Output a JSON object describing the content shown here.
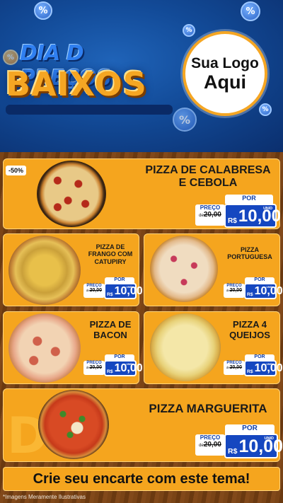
{
  "header": {
    "title_top": "DIA D PREÇOS",
    "title_bottom": "BAIXOS",
    "logo_line1": "Sua Logo",
    "logo_line2": "Aqui",
    "badge_symbol": "%"
  },
  "discount_badge": "-50%",
  "products": [
    {
      "name_lines": [
        "PIZZA DE CALABRESA",
        "E CEBOLA"
      ],
      "por_label": "POR",
      "preco_label": "PREÇO",
      "de_label": "de",
      "old_price": "20,00",
      "currency": "R$",
      "new_price": "10,00",
      "unit": "UNID",
      "pizza_style": "calabresa"
    },
    {
      "name_lines": [
        "PIZZA DE",
        "FRANGO COM",
        "CATUPIRY"
      ],
      "por_label": "POR",
      "preco_label": "PREÇO",
      "de_label": "de",
      "old_price": "20,00",
      "currency": "R$",
      "new_price": "10,00",
      "unit": "UNID",
      "pizza_style": "frango"
    },
    {
      "name_lines": [
        "PIZZA",
        "PORTUGUESA"
      ],
      "por_label": "POR",
      "preco_label": "PREÇO",
      "de_label": "de",
      "old_price": "20,00",
      "currency": "R$",
      "new_price": "10,00",
      "unit": "UNID",
      "pizza_style": "portuguesa"
    },
    {
      "name_lines": [
        "PIZZA DE",
        "BACON"
      ],
      "por_label": "POR",
      "preco_label": "PREÇO",
      "de_label": "de",
      "old_price": "20,00",
      "currency": "R$",
      "new_price": "10,00",
      "unit": "UNID",
      "pizza_style": "bacon"
    },
    {
      "name_lines": [
        "PIZZA 4",
        "QUEIJOS"
      ],
      "por_label": "POR",
      "preco_label": "PREÇO",
      "de_label": "de",
      "old_price": "20,00",
      "currency": "R$",
      "new_price": "10,00",
      "unit": "UNID",
      "pizza_style": "queijos"
    },
    {
      "name_lines": [
        "PIZZA MARGUERITA"
      ],
      "por_label": "POR",
      "preco_label": "PREÇO",
      "de_label": "de",
      "old_price": "20,00",
      "currency": "R$",
      "new_price": "10,00",
      "unit": "UNID",
      "pizza_style": "marguerita"
    }
  ],
  "cta_text": "Crie seu encarte com este tema!",
  "footnote": "*Imagens Meramente Ilustrativas",
  "colors": {
    "brand_blue": "#1547c0",
    "brand_orange": "#f5a51e",
    "background_blue": "#124a97"
  }
}
